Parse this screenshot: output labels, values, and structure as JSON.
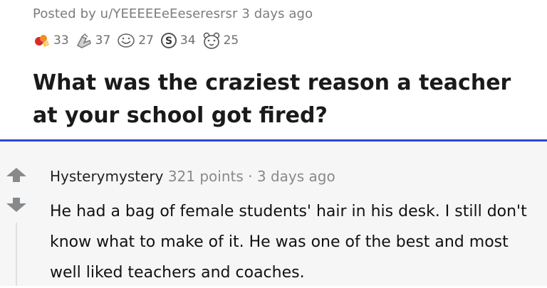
{
  "post": {
    "posted_by": "Posted by u/YEEEEEeEeseresrsr 3 days ago",
    "awards": [
      {
        "icon": "silver-award-icon",
        "count": "33"
      },
      {
        "icon": "helpful-award-icon",
        "count": "37"
      },
      {
        "icon": "wholesome-award-icon",
        "count": "27"
      },
      {
        "icon": "s-coin-award-icon",
        "count": "34"
      },
      {
        "icon": "bear-award-icon",
        "count": "25"
      }
    ],
    "title": "What was the craziest reason a teacher at your school got fired?"
  },
  "comment": {
    "author": "Hysterymystery",
    "points": "321 points",
    "separator": "·",
    "time": "3 days ago",
    "body": "He had a bag of female students' hair in his desk. I still don't know what to make of it. He was one of the best and most well liked teachers and coaches."
  },
  "colors": {
    "divider": "#2f46d9",
    "comment_background": "#f6f6f7",
    "vote_arrow": "#878a8c",
    "title": "#1a1a1b",
    "meta": "#7c7c7c"
  }
}
